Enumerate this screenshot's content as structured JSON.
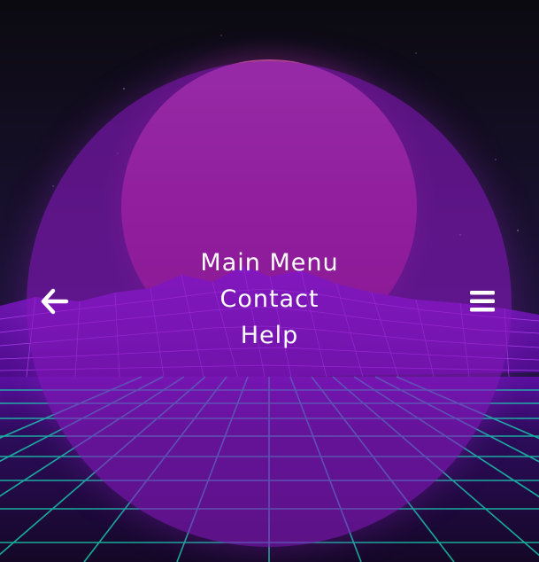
{
  "background": {
    "sky_top": "#0b0a12",
    "sky_bottom": "#2a1450",
    "sun_top": "#a1316f",
    "sun_bottom": "#9a2058",
    "mountain_color": "#9a1fe0",
    "grid_color": "#19c9b0",
    "floor_color": "#3a0f70"
  },
  "overlay": {
    "color": "#8719be"
  },
  "nav": {
    "back_icon": "arrow-left-icon",
    "menu_icon": "hamburger-icon"
  },
  "menu": {
    "items": [
      {
        "label": "Main Menu"
      },
      {
        "label": "Contact"
      },
      {
        "label": "Help"
      }
    ]
  }
}
